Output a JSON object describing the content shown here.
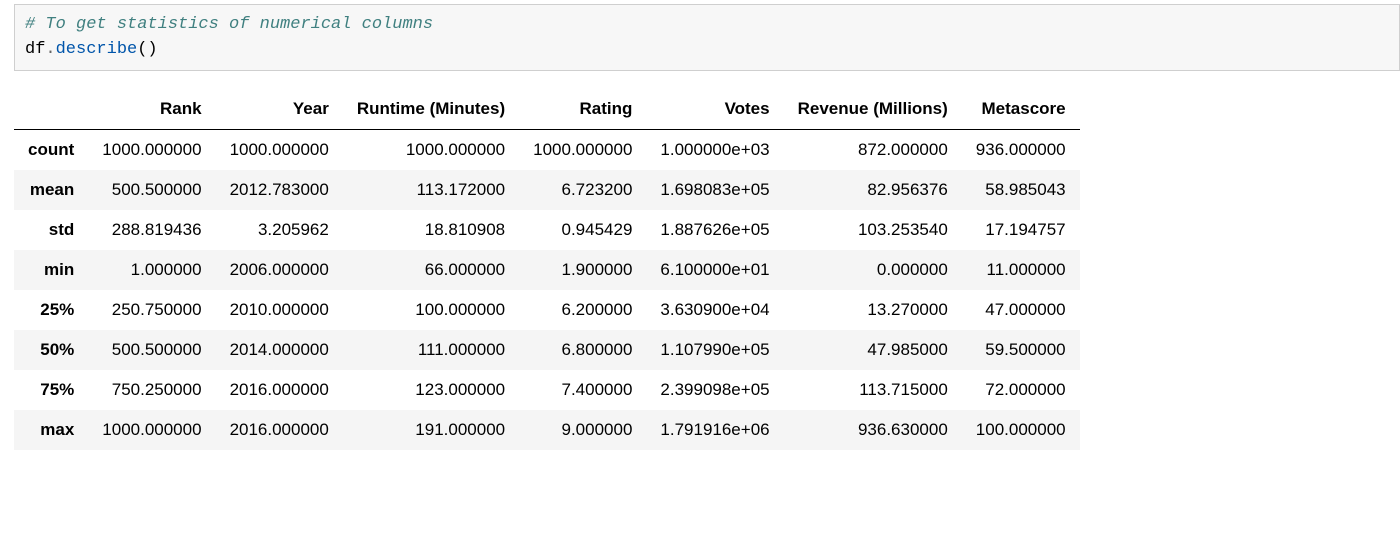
{
  "code": {
    "comment": "# To get statistics of numerical columns",
    "obj": "df",
    "dot": ".",
    "method": "describe",
    "parens": "()"
  },
  "table": {
    "columns": [
      "Rank",
      "Year",
      "Runtime (Minutes)",
      "Rating",
      "Votes",
      "Revenue (Millions)",
      "Metascore"
    ],
    "index": [
      "count",
      "mean",
      "std",
      "min",
      "25%",
      "50%",
      "75%",
      "max"
    ],
    "rows": [
      [
        "1000.000000",
        "1000.000000",
        "1000.000000",
        "1000.000000",
        "1.000000e+03",
        "872.000000",
        "936.000000"
      ],
      [
        "500.500000",
        "2012.783000",
        "113.172000",
        "6.723200",
        "1.698083e+05",
        "82.956376",
        "58.985043"
      ],
      [
        "288.819436",
        "3.205962",
        "18.810908",
        "0.945429",
        "1.887626e+05",
        "103.253540",
        "17.194757"
      ],
      [
        "1.000000",
        "2006.000000",
        "66.000000",
        "1.900000",
        "6.100000e+01",
        "0.000000",
        "11.000000"
      ],
      [
        "250.750000",
        "2010.000000",
        "100.000000",
        "6.200000",
        "3.630900e+04",
        "13.270000",
        "47.000000"
      ],
      [
        "500.500000",
        "2014.000000",
        "111.000000",
        "6.800000",
        "1.107990e+05",
        "47.985000",
        "59.500000"
      ],
      [
        "750.250000",
        "2016.000000",
        "123.000000",
        "7.400000",
        "2.399098e+05",
        "113.715000",
        "72.000000"
      ],
      [
        "1000.000000",
        "2016.000000",
        "191.000000",
        "9.000000",
        "1.791916e+06",
        "936.630000",
        "100.000000"
      ]
    ]
  }
}
